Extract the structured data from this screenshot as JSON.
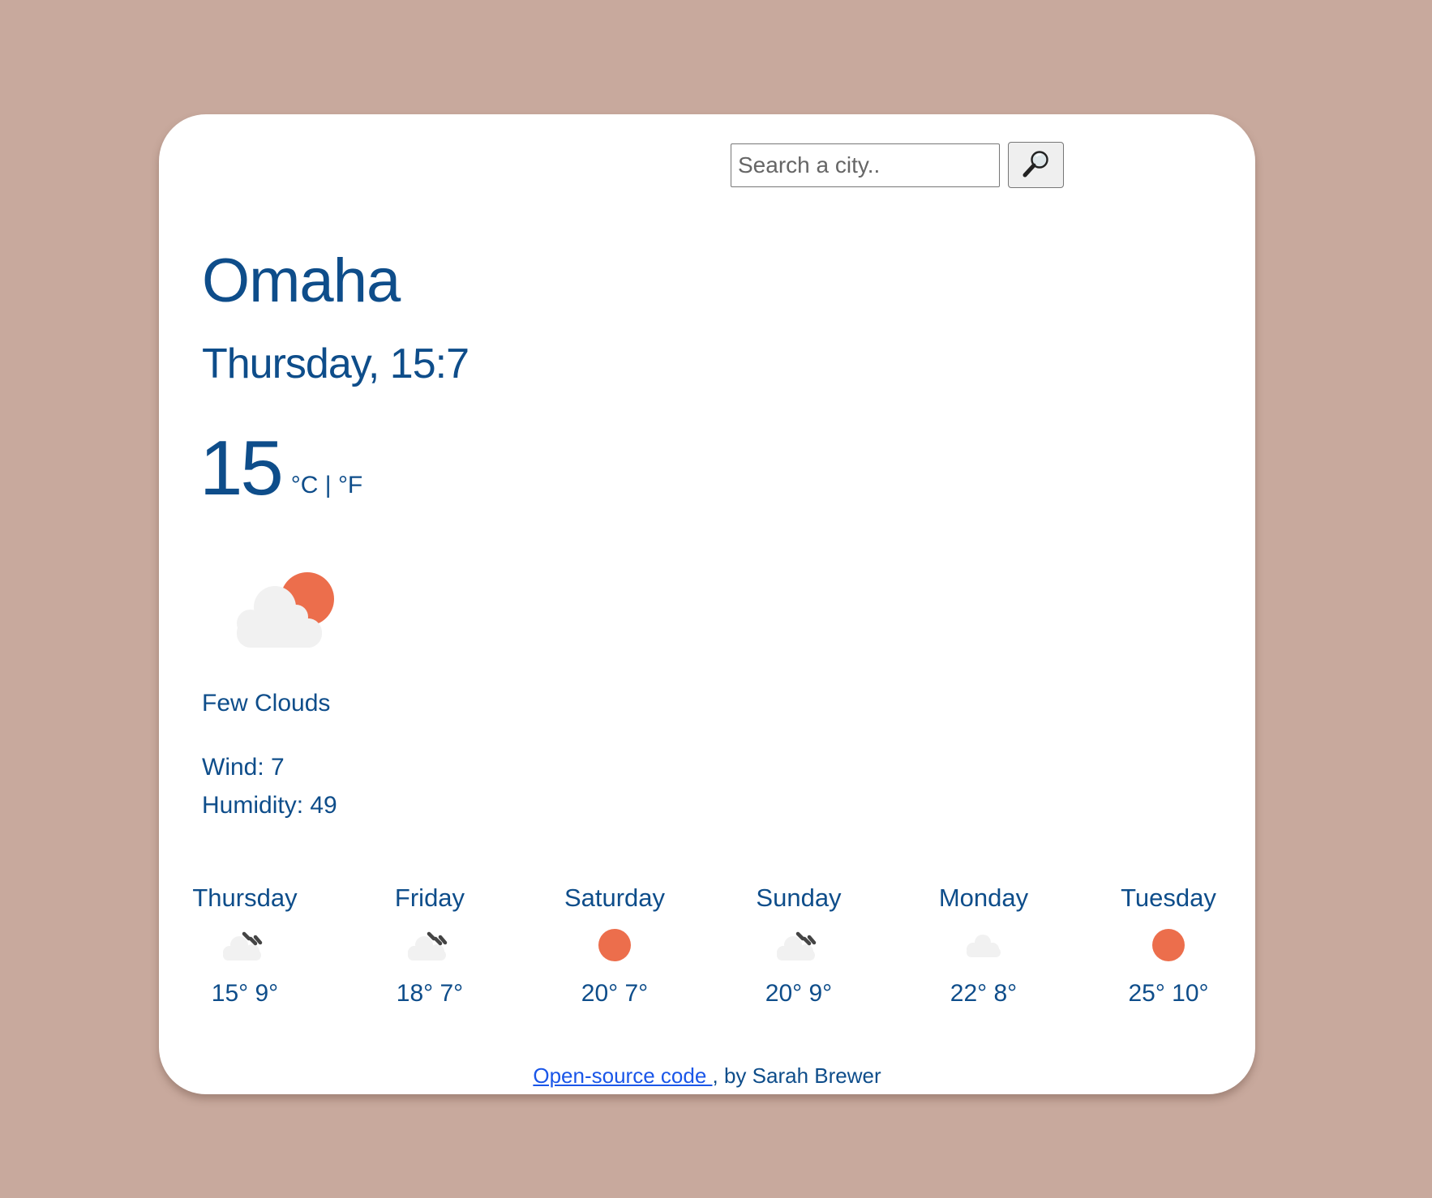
{
  "search": {
    "placeholder": "Search a city..",
    "value": ""
  },
  "current": {
    "city": "Omaha",
    "datetime": "Thursday, 15:7",
    "temperature": "15",
    "unit_c": "°C",
    "unit_separator": "|",
    "unit_f": "°F",
    "icon": "few-clouds-icon",
    "description": "Few Clouds",
    "wind": "Wind: 7",
    "humidity": "Humidity: 49"
  },
  "forecast": [
    {
      "day": "Thursday",
      "icon": "rain-cloud-icon",
      "temps": "15° 9°"
    },
    {
      "day": "Friday",
      "icon": "rain-cloud-icon",
      "temps": "18° 7°"
    },
    {
      "day": "Saturday",
      "icon": "sun-icon",
      "temps": "20° 7°"
    },
    {
      "day": "Sunday",
      "icon": "rain-cloud-icon",
      "temps": "20° 9°"
    },
    {
      "day": "Monday",
      "icon": "cloud-icon",
      "temps": "22° 8°"
    },
    {
      "day": "Tuesday",
      "icon": "sun-icon",
      "temps": "25° 10°"
    }
  ],
  "footer": {
    "link_label": "Open-source code ",
    "suffix": ", by Sarah Brewer"
  },
  "colors": {
    "background": "#c8a99d",
    "card": "#ffffff",
    "text": "#0e4d8a",
    "sun": "#ec6e4c",
    "cloud": "#f1f1f1",
    "rain": "#444444",
    "link": "#1a56e8"
  }
}
